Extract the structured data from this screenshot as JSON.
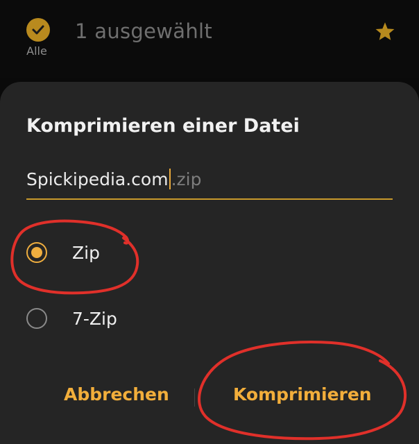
{
  "topbar": {
    "select_all_label": "Alle",
    "selected_count": "1 ausgewählt",
    "icons": {
      "select_all": "check-circle-icon",
      "favorite": "star-icon"
    }
  },
  "dialog": {
    "title": "Komprimieren einer Datei",
    "filename": {
      "value": "Spickipedia.com",
      "extension": ".zip"
    },
    "options": [
      {
        "label": "Zip",
        "selected": true
      },
      {
        "label": "7-Zip",
        "selected": false
      }
    ],
    "buttons": {
      "cancel": "Abbrechen",
      "confirm": "Komprimieren"
    }
  },
  "colors": {
    "accent": "#efae3f",
    "dialog_bg": "#252525",
    "annotation": "#e0302a"
  }
}
